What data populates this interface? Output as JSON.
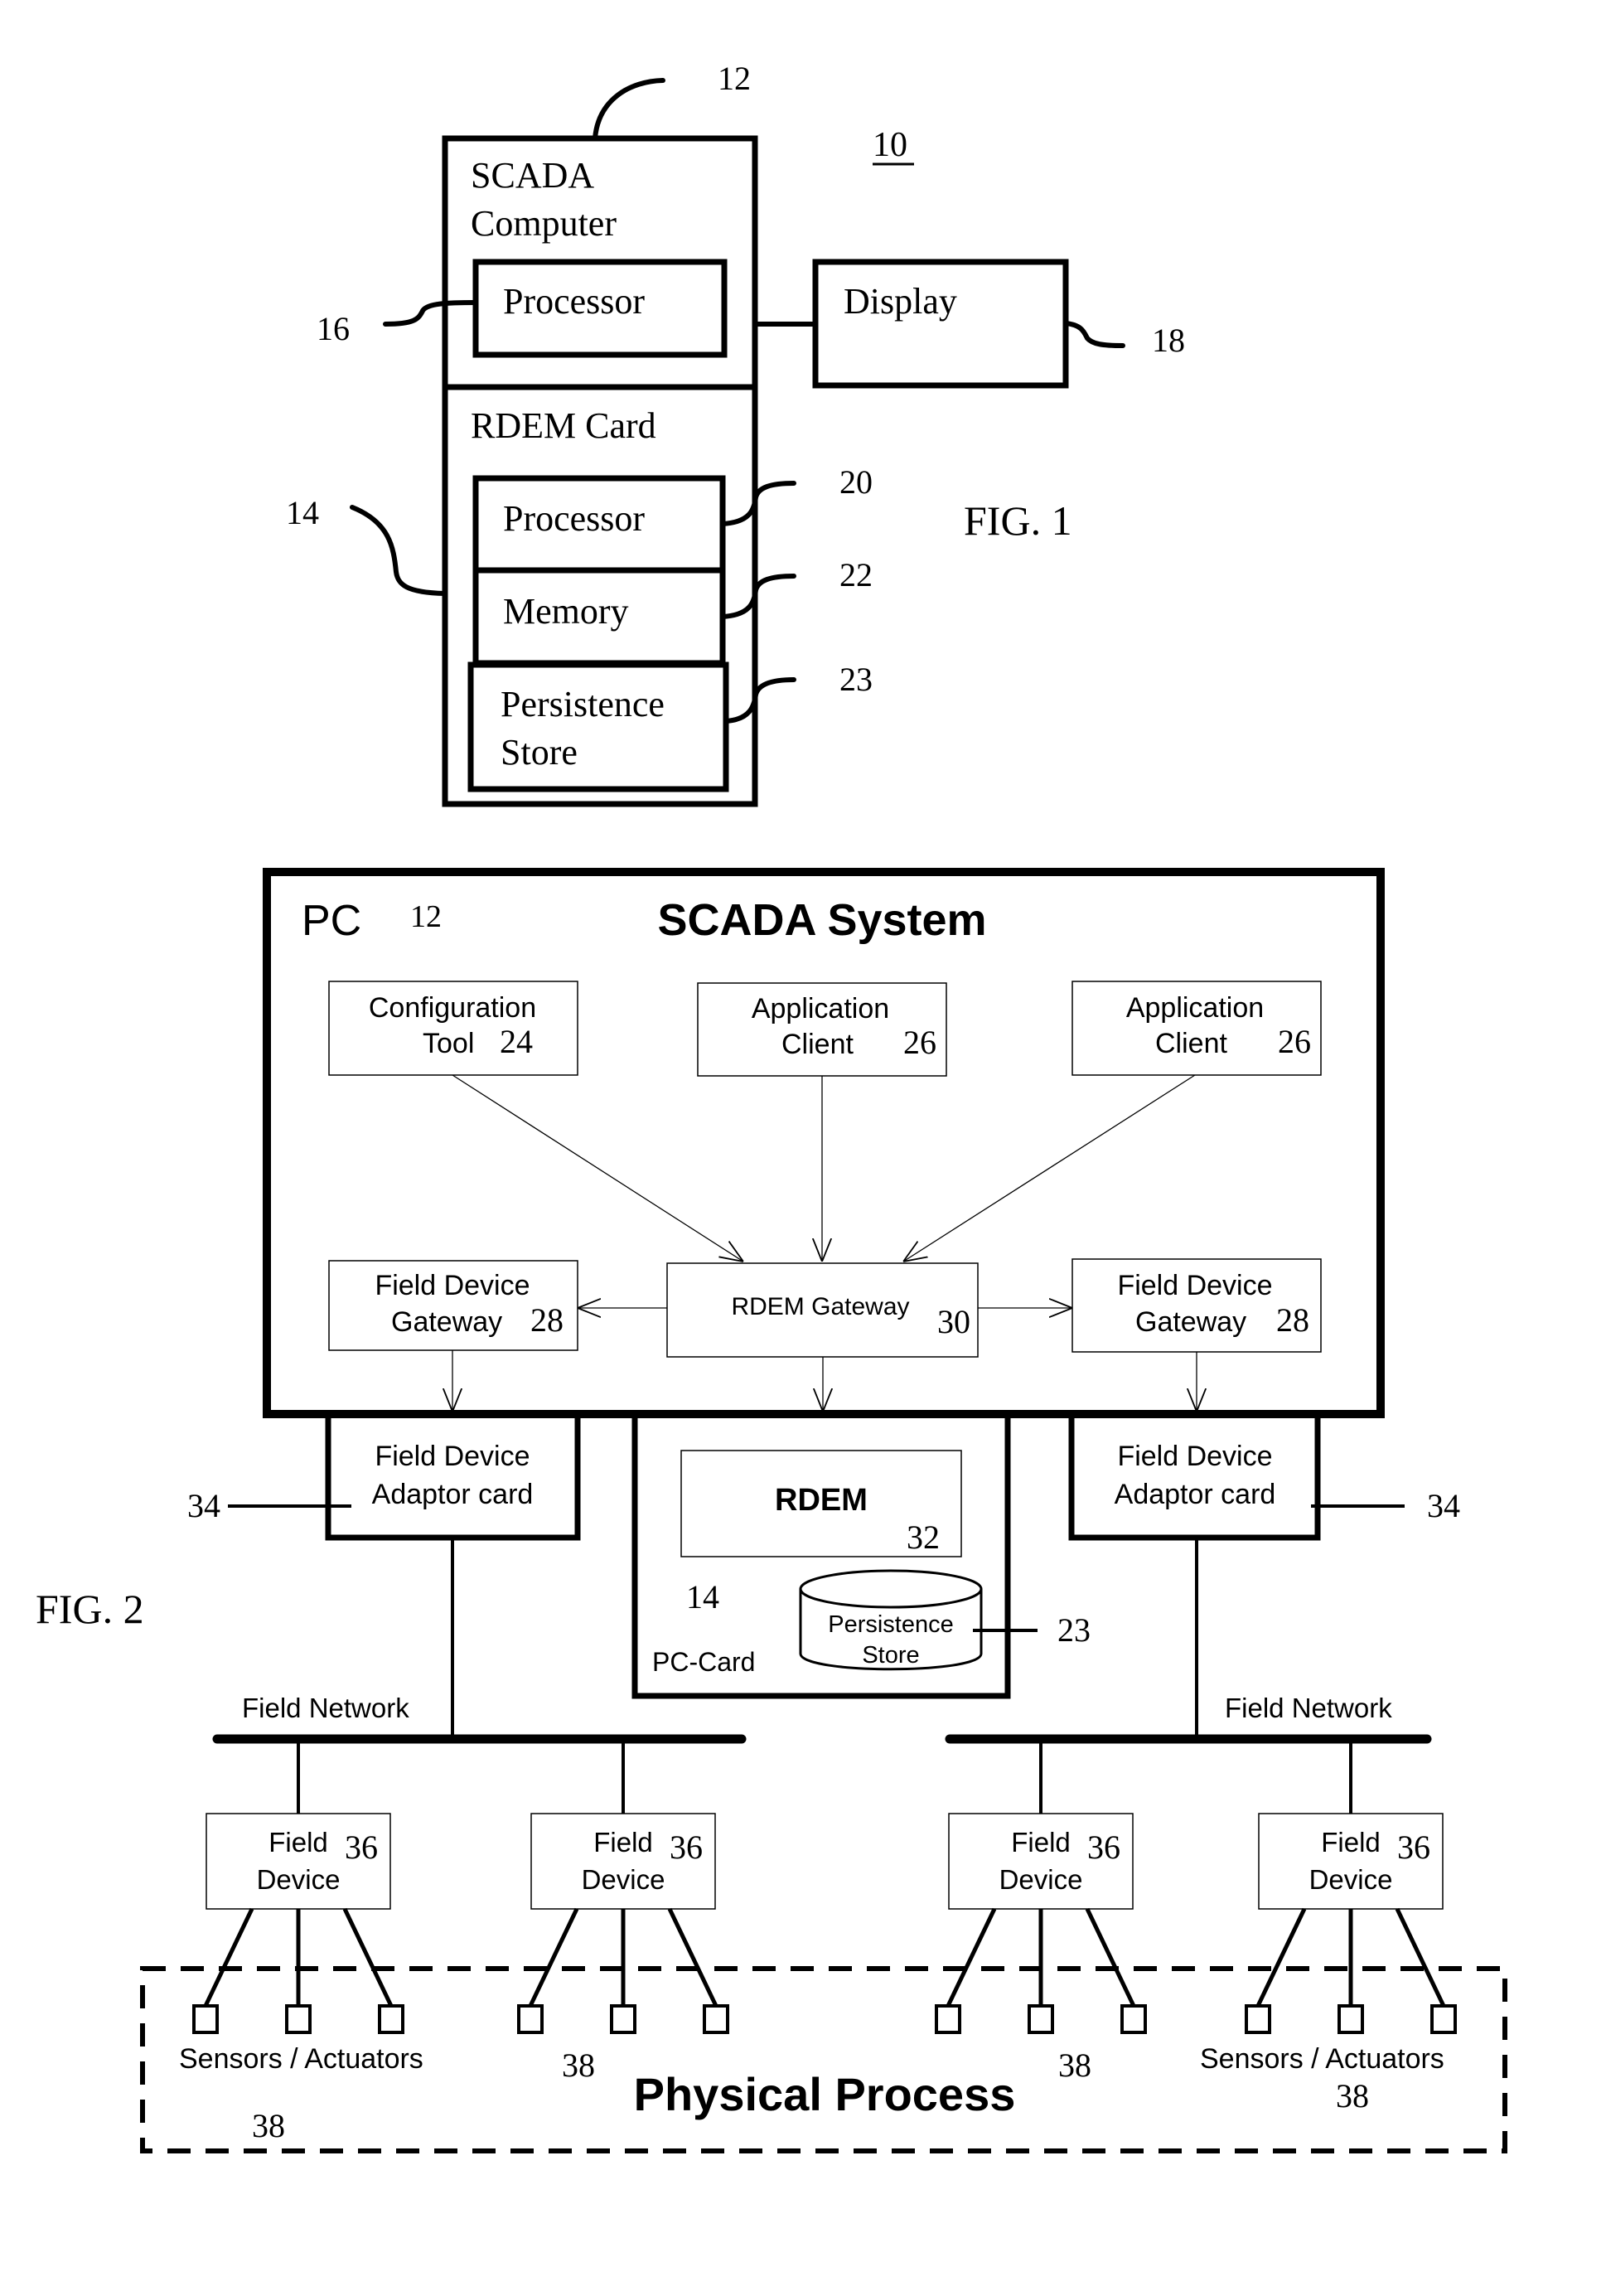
{
  "fig1": {
    "figure_label": "FIG. 1",
    "system_ref": "10",
    "scada_computer": {
      "label_line1": "SCADA",
      "label_line2": "Computer",
      "ref": "12"
    },
    "processor": {
      "label": "Processor",
      "ref": "16"
    },
    "display": {
      "label": "Display",
      "ref": "18"
    },
    "rdem_card": {
      "label": "RDEM Card",
      "ref": "14"
    },
    "card_processor": {
      "label": "Processor",
      "ref": "20"
    },
    "memory": {
      "label": "Memory",
      "ref": "22"
    },
    "persistence_store": {
      "label_line1": "Persistence",
      "label_line2": "Store",
      "ref": "23"
    }
  },
  "fig2": {
    "figure_label": "FIG. 2",
    "pc": {
      "label": "PC",
      "ref": "12",
      "title": "SCADA System"
    },
    "configuration_tool": {
      "label_line1": "Configuration",
      "label_line2": "Tool",
      "ref": "24"
    },
    "application_clients": [
      {
        "label_line1": "Application",
        "label_line2": "Client",
        "ref": "26"
      },
      {
        "label_line1": "Application",
        "label_line2": "Client",
        "ref": "26"
      }
    ],
    "field_device_gateways": [
      {
        "label_line1": "Field Device",
        "label_line2": "Gateway",
        "ref": "28"
      },
      {
        "label_line1": "Field Device",
        "label_line2": "Gateway",
        "ref": "28"
      }
    ],
    "rdem_gateway": {
      "label": "RDEM Gateway",
      "ref": "30"
    },
    "adaptor_cards": [
      {
        "label_line1": "Field Device",
        "label_line2": "Adaptor card",
        "ref": "34"
      },
      {
        "label_line1": "Field Device",
        "label_line2": "Adaptor card",
        "ref": "34"
      }
    ],
    "pc_card": {
      "label": "PC-Card",
      "ref": "14"
    },
    "rdem": {
      "label": "RDEM",
      "ref": "32"
    },
    "persistence_store": {
      "label_line1": "Persistence",
      "label_line2": "Store",
      "ref": "23"
    },
    "field_networks": [
      {
        "label": "Field Network"
      },
      {
        "label": "Field Network"
      }
    ],
    "field_devices": [
      {
        "label_line1": "Field",
        "label_line2": "Device",
        "ref": "36"
      },
      {
        "label_line1": "Field",
        "label_line2": "Device",
        "ref": "36"
      },
      {
        "label_line1": "Field",
        "label_line2": "Device",
        "ref": "36"
      },
      {
        "label_line1": "Field",
        "label_line2": "Device",
        "ref": "36"
      }
    ],
    "sensors_actuators": [
      {
        "label": "Sensors / Actuators",
        "ref": "38"
      },
      {
        "ref": "38"
      },
      {
        "ref": "38"
      },
      {
        "label": "Sensors / Actuators",
        "ref": "38"
      }
    ],
    "physical_process": {
      "label": "Physical Process"
    }
  }
}
